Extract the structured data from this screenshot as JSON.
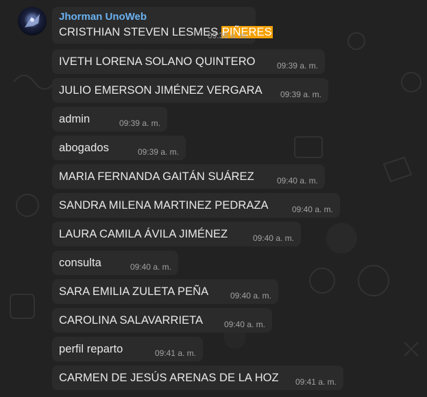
{
  "sender": "Jhorman UnoWeb",
  "messages": [
    {
      "pre": "CRISTHIAN STEVEN LESMES ",
      "highlight": "PIÑERES",
      "time": "09:38 a. m."
    },
    {
      "text": "IVETH LORENA SOLANO QUINTERO",
      "time": "09:39 a. m."
    },
    {
      "text": "JULIO EMERSON JIMÉNEZ VERGARA",
      "time": "09:39 a. m."
    },
    {
      "text": "admin",
      "time": "09:39 a. m."
    },
    {
      "text": "abogados",
      "time": "09:39 a. m."
    },
    {
      "text": "MARIA FERNANDA GAITÁN SUÁREZ",
      "time": "09:40 a. m."
    },
    {
      "text": "SANDRA MILENA MARTINEZ PEDRAZA",
      "time": "09:40 a. m."
    },
    {
      "text": "LAURA CAMILA ÁVILA JIMÉNEZ",
      "time": "09:40 a. m."
    },
    {
      "text": "consulta",
      "time": "09:40 a. m."
    },
    {
      "text": "SARA EMILIA ZULETA PEÑA",
      "time": "09:40 a. m."
    },
    {
      "text": "CAROLINA SALAVARRIETA",
      "time": "09:40 a. m."
    },
    {
      "text": "perfil reparto",
      "time": "09:41 a. m."
    },
    {
      "text": "CARMEN DE JESÚS ARENAS DE LA HOZ",
      "time": "09:41 a. m."
    }
  ],
  "colors": {
    "highlight": "#f5a000",
    "sender": "#6ab2f2",
    "bubble": "#2b2b2b"
  }
}
